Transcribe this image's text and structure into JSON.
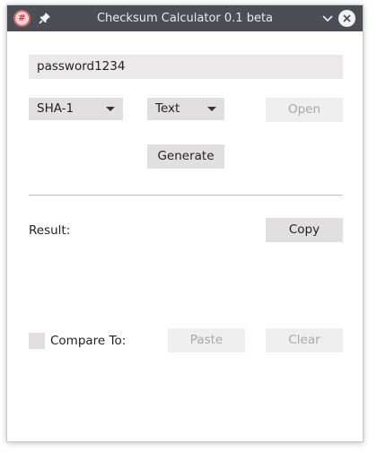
{
  "window": {
    "title": "Checksum Calculator 0.1 beta"
  },
  "icons": {
    "app": "hash-icon",
    "pin": "pin-icon",
    "minimize": "chevron-down-icon",
    "close": "close-icon"
  },
  "form": {
    "input_value": "password1234",
    "algorithm_selected": "SHA-1",
    "input_type_selected": "Text",
    "open_label": "Open",
    "generate_label": "Generate",
    "result_label": "Result:",
    "copy_label": "Copy",
    "compare_label": "Compare To:",
    "paste_label": "Paste",
    "clear_label": "Clear",
    "compare_checked": false
  }
}
